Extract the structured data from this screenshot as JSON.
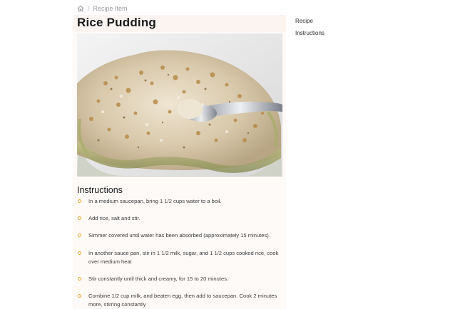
{
  "breadcrumb": {
    "home_icon": "home-icon",
    "separator": "/",
    "current": "Recipe Item"
  },
  "recipe": {
    "title": "Rice Pudding",
    "image_alt": "Bowl of rice pudding topped with toasted coconut and a spoon"
  },
  "instructions": {
    "heading": "Instructions",
    "bullet_color": "#f0a21a",
    "steps": [
      "In a medium saucepan, bring 1 1/2 cups water to a boil.",
      "Add rice, salt and stir.",
      "Simmer covered until water has been absorbed (approximately 15 minutes).",
      "In another sauce pan, stir in 1 1/2 milk, sugar, and 1 1/2 cups cooked rice, cook over medium heat",
      "Stir constantly until thick and creamy, for 15 to 20 minutes.",
      "Combine 1/2 cup milk, and beaten egg, then add to saucepan. Cook 2 minutes more, stirring constantly"
    ]
  },
  "side_nav": {
    "items": [
      "Recipe",
      "Instructions"
    ]
  }
}
